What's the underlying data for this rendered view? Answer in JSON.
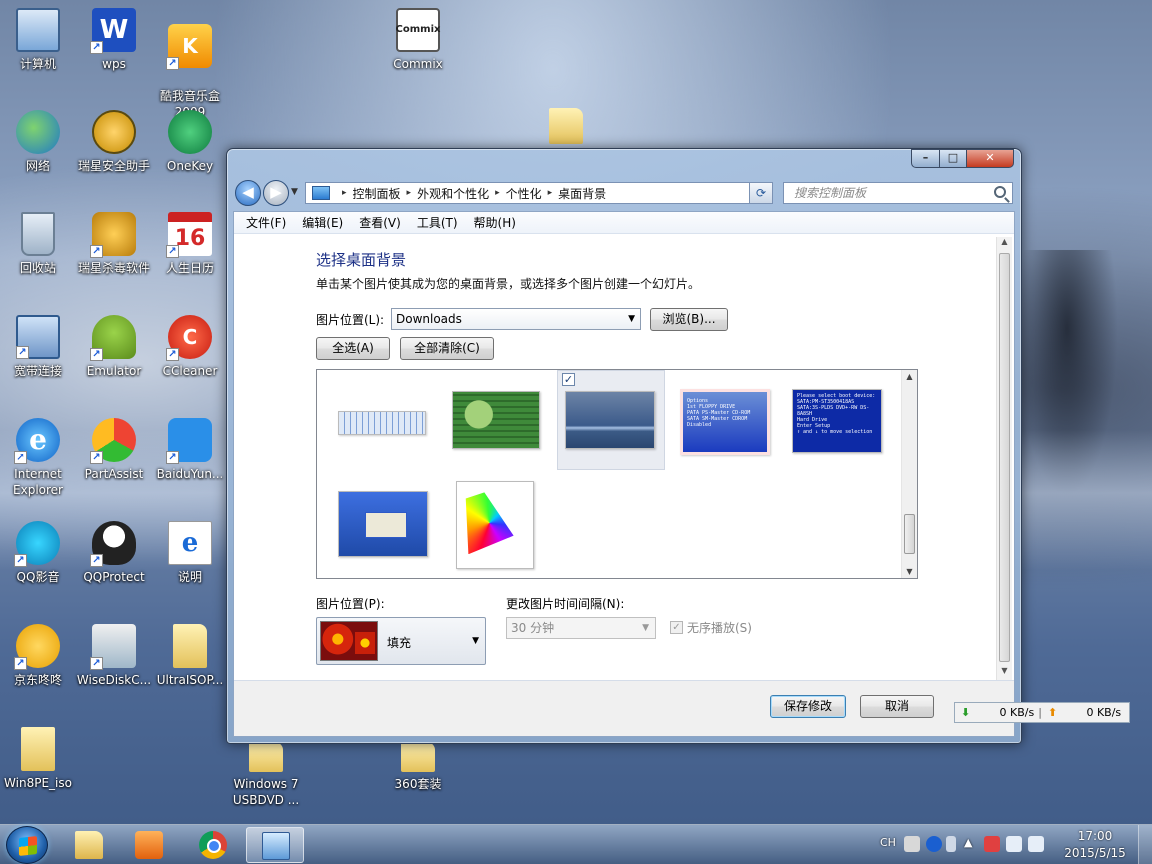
{
  "desktop": {
    "icons": [
      {
        "label": "计算机",
        "icon": "computer-icon"
      },
      {
        "label": "wps",
        "icon": "wps-icon",
        "glyph": "W"
      },
      {
        "label": "酷我音乐盒\n2009",
        "icon": "kuwo-music-icon",
        "glyph": "K"
      },
      {
        "label": "Commix",
        "icon": "commix-icon",
        "glyph": "Commix"
      },
      {
        "label": "网络",
        "icon": "network-icon"
      },
      {
        "label": "瑞星安全助手",
        "icon": "rising-assistant-icon"
      },
      {
        "label": "OneKey",
        "icon": "onekey-icon"
      },
      {
        "label": "回收站",
        "icon": "recycle-bin-icon"
      },
      {
        "label": "瑞星杀毒软件",
        "icon": "rising-antivirus-icon"
      },
      {
        "label": "人生日历",
        "icon": "calendar-icon",
        "glyph": "16",
        "header": "四月"
      },
      {
        "label": "宽带连接",
        "icon": "broadband-icon"
      },
      {
        "label": "Emulator",
        "icon": "android-emulator-icon"
      },
      {
        "label": "CCleaner",
        "icon": "ccleaner-icon",
        "glyph": "C"
      },
      {
        "label": "Internet Explorer",
        "icon": "internet-explorer-icon",
        "glyph": "e"
      },
      {
        "label": "PartAssist",
        "icon": "partassist-icon"
      },
      {
        "label": "BaiduYun...",
        "icon": "baiduyun-icon"
      },
      {
        "label": "QQ影音",
        "icon": "qqplayer-icon"
      },
      {
        "label": "QQProtect",
        "icon": "qq-icon"
      },
      {
        "label": "说明",
        "icon": "readme-icon",
        "glyph": "e"
      },
      {
        "label": "京东咚咚",
        "icon": "jd-icon"
      },
      {
        "label": "WiseDiskC...",
        "icon": "wisedisk-icon"
      },
      {
        "label": "UltraISOP...",
        "icon": "ultraiso-folder-icon"
      },
      {
        "label": "Win8PE_iso",
        "icon": "win8pe-folder-icon"
      },
      {
        "label": "Windows 7 USBDVD ...",
        "icon": "usbdvd-folder-icon"
      },
      {
        "label": "360套装",
        "icon": "360-folder-icon"
      }
    ]
  },
  "window": {
    "nav": {
      "back_glyph": "◀",
      "forward_glyph": "▶",
      "crumbs": [
        "控制面板",
        "外观和个性化",
        "个性化",
        "桌面背景"
      ],
      "separator": "▸",
      "refresh_glyph": "⟳",
      "search_placeholder": "搜索控制面板"
    },
    "menu": [
      "文件(F)",
      "编辑(E)",
      "查看(V)",
      "工具(T)",
      "帮助(H)"
    ],
    "title": "选择桌面背景",
    "description": "单击某个图片使其成为您的桌面背景，或选择多个图片创建一个幻灯片。",
    "location_label": "图片位置(L):",
    "location_value": "Downloads",
    "browse_button": "浏览(B)...",
    "select_all_button": "全选(A)",
    "clear_all_button": "全部清除(C)",
    "pictures": [
      {
        "name": "keyboard-picture",
        "selected": false
      },
      {
        "name": "circuit-board-picture",
        "selected": false
      },
      {
        "name": "lake-wallpaper-picture",
        "selected": true,
        "check": "✓"
      },
      {
        "name": "bios-options-picture",
        "selected": false,
        "lines": [
          "Options",
          "1st FLOPPY DRIVE",
          "PATA PS-Master CD-ROM",
          "SATA SM-Master CDROM",
          "Disabled"
        ]
      },
      {
        "name": "boot-device-picture",
        "selected": false,
        "lines": [
          "Please select boot device:",
          "SATA:PM-ST3500418AS",
          "SATA:3S-PLDS DVD+-RW DS-8A8SH",
          "Hard Drive",
          "Enter Setup",
          "↑ and ↓ to move selection"
        ]
      },
      {
        "name": "windows-xp-setup-picture",
        "selected": false
      },
      {
        "name": "cie-chromaticity-picture",
        "selected": false
      }
    ],
    "position_label": "图片位置(P):",
    "position_value": "填充",
    "interval_label": "更改图片时间间隔(N):",
    "interval_value": "30 分钟",
    "shuffle_label": "无序播放(S)",
    "save_button": "保存修改",
    "cancel_button": "取消"
  },
  "netspeed": {
    "down": "0 KB/s",
    "up": "0 KB/s",
    "divider": "|"
  },
  "taskbar": {
    "lang": "CH",
    "time": "17:00",
    "date": "2015/5/15"
  }
}
